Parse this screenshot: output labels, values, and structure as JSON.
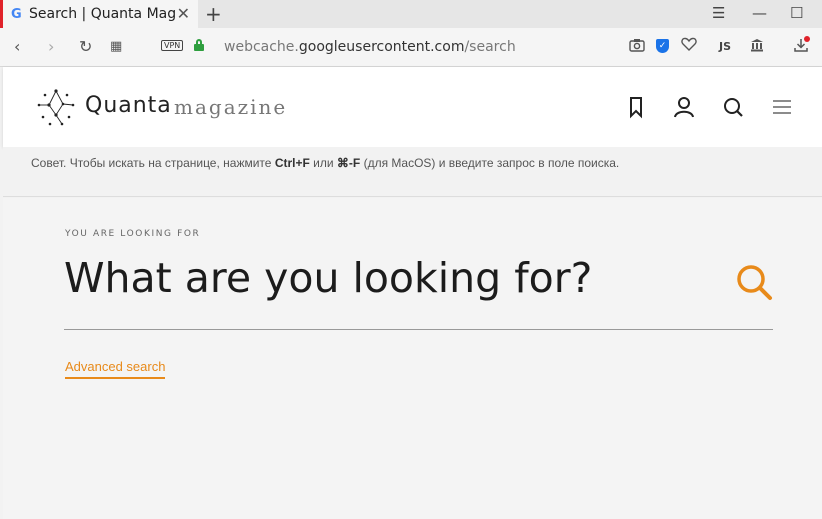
{
  "browser": {
    "tab": {
      "favicon": "G",
      "title": "Search | Quanta Magazine",
      "close": "✕"
    },
    "new_tab": "+",
    "window_controls": {
      "tabs_menu": "☰",
      "minimize": "—",
      "maximize": "☐",
      "close": "✕"
    },
    "vpn_label": "VPN",
    "url": {
      "prefix": "webcache.",
      "host": "googleusercontent.com",
      "path": "/search"
    },
    "js_label": "JS"
  },
  "site": {
    "logo_primary": "Quanta",
    "logo_secondary": "magazine"
  },
  "tip": {
    "part1": "Совет. Чтобы искать на странице, нажмите ",
    "key1": "Ctrl+F",
    "part2": " или ",
    "key2": "⌘-F",
    "part3": " (для MacOS) и введите запрос в поле поиска."
  },
  "search": {
    "eyebrow": "YOU ARE LOOKING FOR",
    "placeholder": "What are you looking for?",
    "advanced_label": "Advanced search"
  },
  "colors": {
    "accent": "#e88a1a",
    "tab_marker": "#e0222a",
    "lock": "#2e9e3e",
    "shield": "#1a73e8"
  }
}
